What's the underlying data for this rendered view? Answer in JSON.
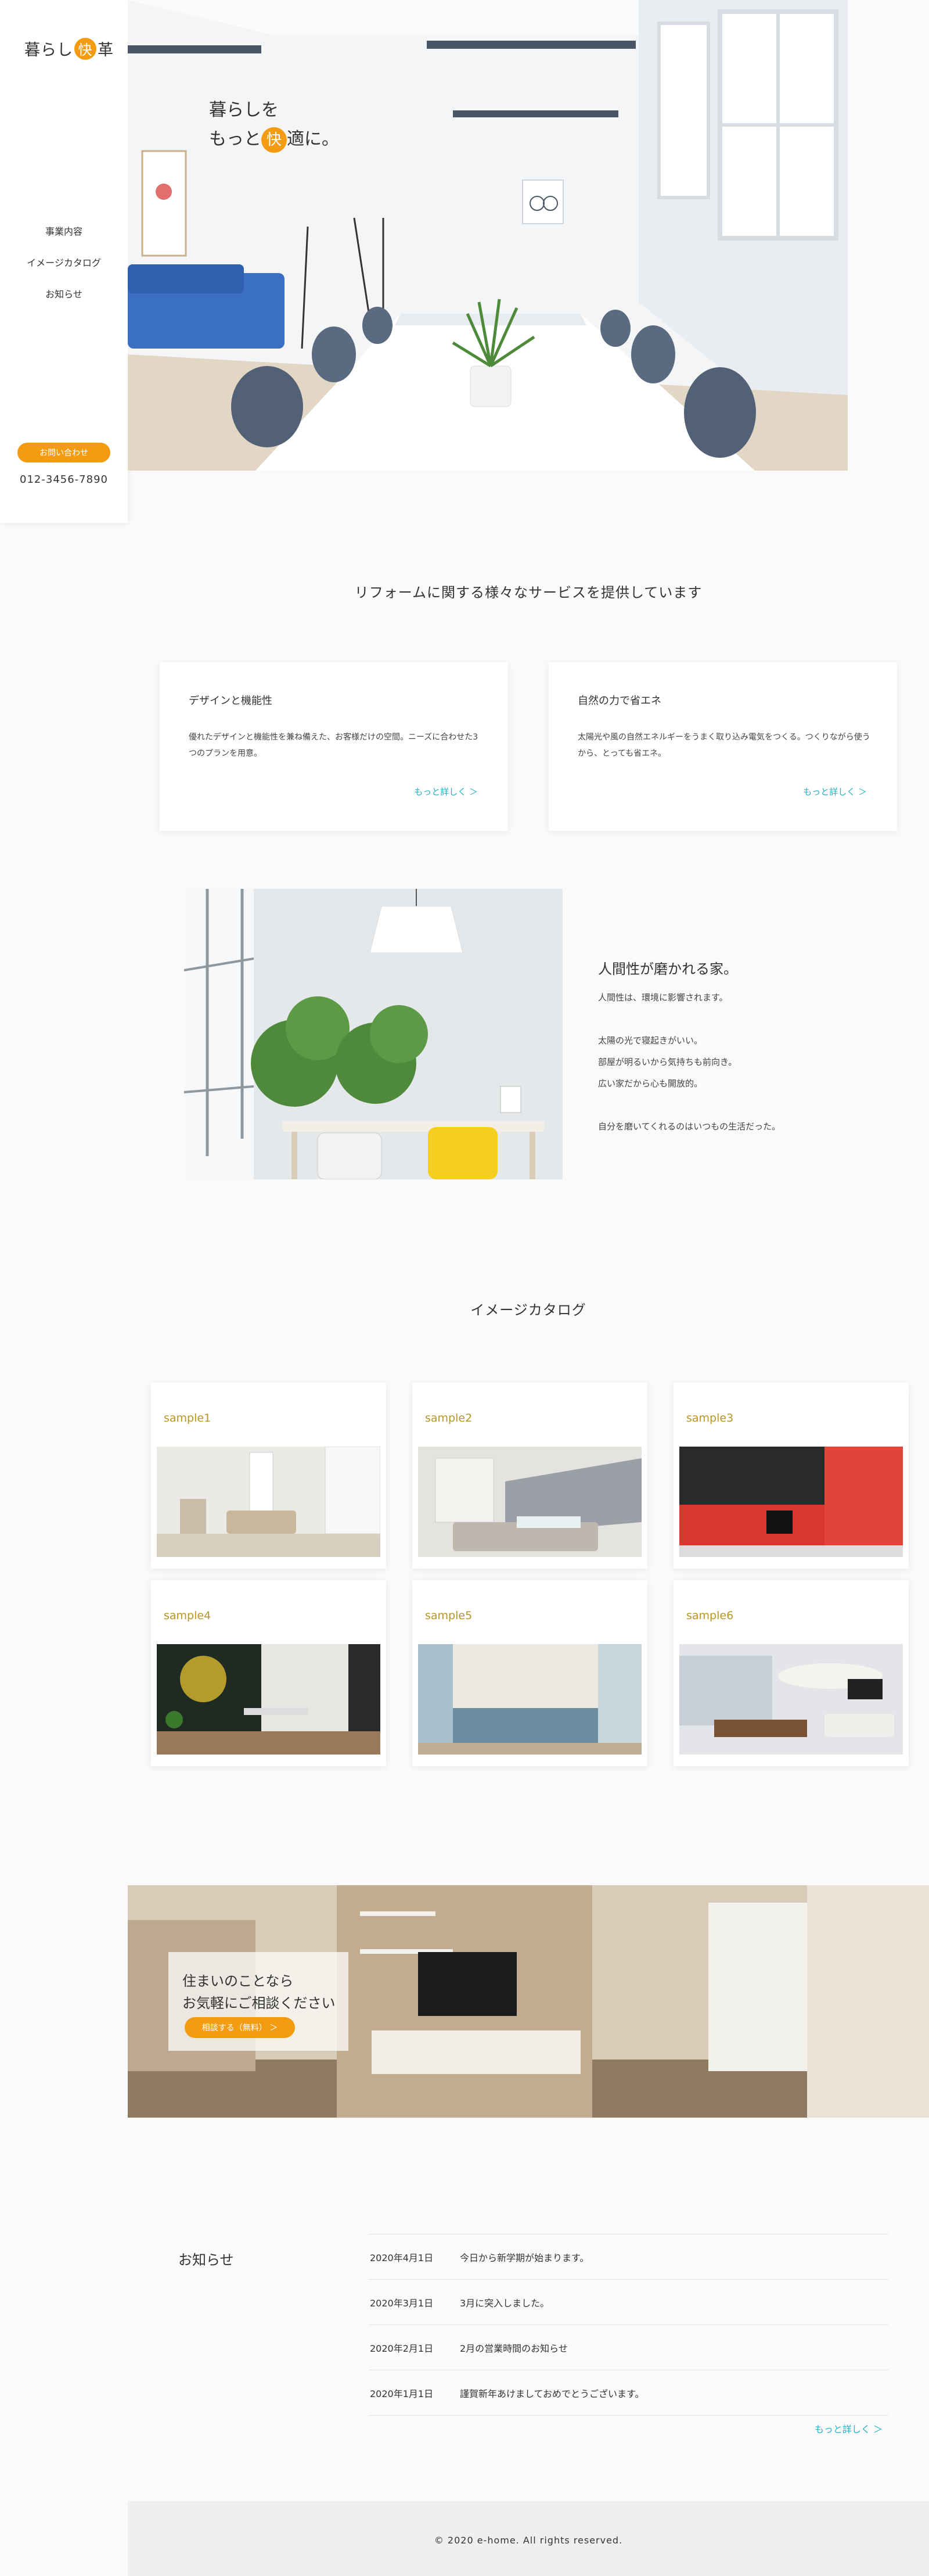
{
  "sidebar": {
    "logo_pre": "暮らし",
    "logo_accent": "快",
    "logo_post": "革",
    "nav": [
      "事業内容",
      "イメージカタログ",
      "お知らせ"
    ],
    "contact_label": "お問い合わせ",
    "phone": "012-3456-7890"
  },
  "hero": {
    "line1": "暮らしを",
    "line2_pre": "もっと",
    "line2_accent": "快",
    "line2_post": "適に。"
  },
  "services": {
    "title": "リフォームに関する様々なサービスを提供しています",
    "cards": [
      {
        "title": "デザインと機能性",
        "desc": "優れたデザインと機能性を兼ね備えた、お客様だけの空間。ニーズに合わせた3つのプランを用意。",
        "more": "もっと詳しく ＞"
      },
      {
        "title": "自然の力で省エネ",
        "desc": "太陽光や風の自然エネルギーをうまく取り込み電気をつくる。つくりながら使うから、とっても省エネ。",
        "more": "もっと詳しく ＞"
      }
    ]
  },
  "feature": {
    "heading": "人間性が磨かれる家。",
    "lines": [
      "人間性は、環境に影響されます。",
      "",
      "太陽の光で寝起きがいい。",
      "部屋が明るいから気持ちも前向き。",
      "広い家だから心も開放的。",
      "",
      "自分を磨いてくれるのはいつもの生活だった。"
    ]
  },
  "catalog": {
    "title": "イメージカタログ",
    "items": [
      {
        "name": "sample1"
      },
      {
        "name": "sample2"
      },
      {
        "name": "sample3"
      },
      {
        "name": "sample4"
      },
      {
        "name": "sample5"
      },
      {
        "name": "sample6"
      }
    ]
  },
  "consult": {
    "line1": "住まいのことなら",
    "line2": "お気軽にご相談ください",
    "button": "相談する（無料） ＞"
  },
  "news": {
    "title": "お知らせ",
    "items": [
      {
        "date": "2020年4月1日",
        "text": "今日から新学期が始まります。"
      },
      {
        "date": "2020年3月1日",
        "text": "3月に突入しました。"
      },
      {
        "date": "2020年2月1日",
        "text": "2月の営業時間のお知らせ"
      },
      {
        "date": "2020年1月1日",
        "text": "謹賀新年あけましておめでとうございます。"
      }
    ],
    "more": "もっと詳しく ＞"
  },
  "footer": {
    "copyright": "© 2020 e-home. All rights reserved."
  },
  "colors": {
    "accent": "#f39c12",
    "link": "#21b2c7",
    "sample_label": "#b89524"
  }
}
